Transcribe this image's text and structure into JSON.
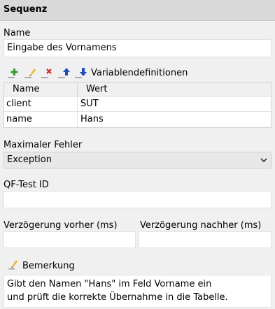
{
  "header": {
    "title": "Sequenz"
  },
  "name": {
    "label": "Name",
    "value": "Eingabe des Vornamens"
  },
  "variables": {
    "label": "Variablendefinitionen",
    "toolbar_icons": [
      "add-icon",
      "edit-icon",
      "delete-icon",
      "move-up-icon",
      "move-down-icon"
    ],
    "columns": [
      "Name",
      "Wert"
    ],
    "rows": [
      {
        "name": "client",
        "value": "SUT"
      },
      {
        "name": "name",
        "value": "Hans"
      }
    ]
  },
  "max_error": {
    "label": "Maximaler Fehler",
    "selected": "Exception"
  },
  "qftest_id": {
    "label": "QF-Test ID",
    "value": ""
  },
  "delay_before": {
    "label": "Verzögerung vorher (ms)",
    "value": ""
  },
  "delay_after": {
    "label": "Verzögerung nachher (ms)",
    "value": ""
  },
  "comment": {
    "label": "Bemerkung",
    "lines": [
      "Gibt den Namen \"Hans\" im Feld Vorname ein",
      "und prüft die korrekte Übernahme in die Tabelle."
    ]
  },
  "colors": {
    "add": "#2e9b2e",
    "delete": "#cc2222",
    "arrow": "#1f4fb8",
    "pencil": "#e3b81f"
  }
}
